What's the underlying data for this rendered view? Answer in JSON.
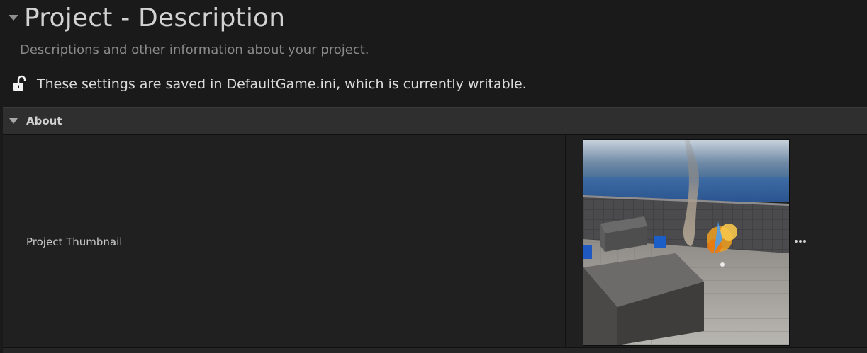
{
  "header": {
    "title": "Project - Description",
    "subtitle": "Descriptions and other information about your project.",
    "save_status": "These settings are saved in DefaultGame.ini, which is currently writable.",
    "lock_icon": "unlocked-padlock-icon"
  },
  "section": {
    "title": "About",
    "rows": [
      {
        "label": "Project Thumbnail",
        "more_icon": "ellipsis-icon"
      }
    ]
  }
}
